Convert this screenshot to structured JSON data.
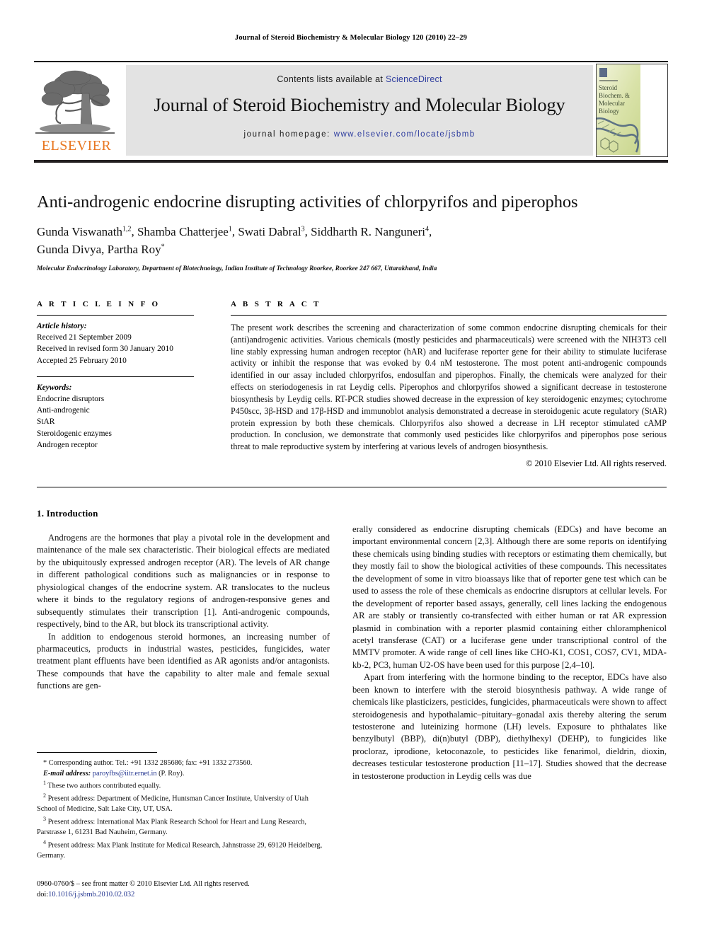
{
  "running_head": "Journal of Steroid Biochemistry & Molecular Biology 120 (2010) 22–29",
  "masthead": {
    "contents_prefix": "Contents lists available at",
    "sciencedirect": "ScienceDirect",
    "journal_title": "Journal of Steroid Biochemistry and Molecular Biology",
    "homepage_label": "journal homepage:",
    "homepage_url": "www.elsevier.com/locate/jsbmb",
    "publisher": "ELSEVIER",
    "cover_lines": [
      "Steroid",
      "Biochemistry &",
      "Molecular",
      "Biology"
    ],
    "colors": {
      "elsevier_orange": "#E87722",
      "link_blue": "#2d3c9e",
      "masthead_bg": "#e3e3e3"
    }
  },
  "article": {
    "title": "Anti-androgenic endocrine disrupting activities of chlorpyrifos and piperophos",
    "authors_line1": "Gunda Viswanath",
    "authors_line1_sup1": "1,2",
    "authors_line1_b": ", Shamba Chatterjee",
    "authors_line1_sup2": "1",
    "authors_line1_c": ", Swati Dabral",
    "authors_line1_sup3": "3",
    "authors_line1_d": ", Siddharth R. Nanguneri",
    "authors_line1_sup4": "4",
    "authors_line1_e": ",",
    "authors_line2": "Gunda Divya, Partha Roy",
    "authors_line2_star": "*",
    "affiliation": "Molecular Endocrinology Laboratory, Department of Biotechnology, Indian Institute of Technology Roorkee, Roorkee 247 667, Uttarakhand, India"
  },
  "article_info": {
    "heading": "A R T I C L E   I N F O",
    "history_label": "Article history:",
    "history": [
      "Received 21 September 2009",
      "Received in revised form 30 January 2010",
      "Accepted 25 February 2010"
    ],
    "keywords_label": "Keywords:",
    "keywords": [
      "Endocrine disruptors",
      "Anti-androgenic",
      "StAR",
      "Steroidogenic enzymes",
      "Androgen receptor"
    ]
  },
  "abstract": {
    "heading": "A B S T R A C T",
    "text": "The present work describes the screening and characterization of some common endocrine disrupting chemicals for their (anti)androgenic activities. Various chemicals (mostly pesticides and pharmaceuticals) were screened with the NIH3T3 cell line stably expressing human androgen receptor (hAR) and luciferase reporter gene for their ability to stimulate luciferase activity or inhibit the response that was evoked by 0.4 nM testosterone. The most potent anti-androgenic compounds identified in our assay included chlorpyrifos, endosulfan and piperophos. Finally, the chemicals were analyzed for their effects on steriodogenesis in rat Leydig cells. Piperophos and chlorpyrifos showed a significant decrease in testosterone biosynthesis by Leydig cells. RT-PCR studies showed decrease in the expression of key steroidogenic enzymes; cytochrome P450scc, 3β-HSD and 17β-HSD and immunoblot analysis demonstrated a decrease in steroidogenic acute regulatory (StAR) protein expression by both these chemicals. Chlorpyrifos also showed a decrease in LH receptor stimulated cAMP production. In conclusion, we demonstrate that commonly used pesticides like chlorpyrifos and piperophos pose serious threat to male reproductive system by interfering at various levels of androgen biosynthesis.",
    "copyright": "© 2010 Elsevier Ltd. All rights reserved."
  },
  "body": {
    "section1_heading": "1. Introduction",
    "left_paragraphs": [
      "Androgens are the hormones that play a pivotal role in the development and maintenance of the male sex characteristic. Their biological effects are mediated by the ubiquitously expressed androgen receptor (AR). The levels of AR change in different pathological conditions such as malignancies or in response to physiological changes of the endocrine system. AR translocates to the nucleus where it binds to the regulatory regions of androgen-responsive genes and subsequently stimulates their transcription [1]. Anti-androgenic compounds, respectively, bind to the AR, but block its transcriptional activity.",
      "In addition to endogenous steroid hormones, an increasing number of pharmaceutics, products in industrial wastes, pesticides, fungicides, water treatment plant effluents have been identified as AR agonists and/or antagonists. These compounds that have the capability to alter male and female sexual functions are gen-"
    ],
    "right_paragraphs": [
      "erally considered as endocrine disrupting chemicals (EDCs) and have become an important environmental concern [2,3]. Although there are some reports on identifying these chemicals using binding studies with receptors or estimating them chemically, but they mostly fail to show the biological activities of these compounds. This necessitates the development of some in vitro bioassays like that of reporter gene test which can be used to assess the role of these chemicals as endocrine disruptors at cellular levels. For the development of reporter based assays, generally, cell lines lacking the endogenous AR are stably or transiently co-transfected with either human or rat AR expression plasmid in combination with a reporter plasmid containing either chloramphenicol acetyl transferase (CAT) or a luciferase gene under transcriptional control of the MMTV promoter. A wide range of cell lines like CHO-K1, COS1, COS7, CV1, MDA-kb-2, PC3, human U2-OS have been used for this purpose [2,4–10].",
      "Apart from interfering with the hormone binding to the receptor, EDCs have also been known to interfere with the steroid biosynthesis pathway. A wide range of chemicals like plasticizers, pesticides, fungicides, pharmaceuticals were shown to affect steroidogenesis and hypothalamic–pituitary–gonadal axis thereby altering the serum testosterone and luteinizing hormone (LH) levels. Exposure to phthalates like benzylbutyl (BBP), di(n)butyl (DBP), diethylhexyl (DEHP), to fungicides like procloraz, iprodione, ketoconazole, to pesticides like fenarimol, dieldrin, dioxin, decreases testicular testosterone production [11–17]. Studies showed that the decrease in testosterone production in Leydig cells was due"
    ]
  },
  "footnotes": {
    "corresponding": "* Corresponding author. Tel.: +91 1332 285686; fax: +91 1332 273560.",
    "email_label": "E-mail address:",
    "email": "paroyfbs@iitr.ernet.in",
    "email_suffix": "(P. Roy).",
    "note1_sup": "1",
    "note1": "These two authors contributed equally.",
    "note2_sup": "2",
    "note2": "Present address: Department of Medicine, Huntsman Cancer Institute, University of Utah School of Medicine, Salt Lake City, UT, USA.",
    "note3_sup": "3",
    "note3": "Present address: International Max Plank Research School for Heart and Lung Research, Parstrasse 1, 61231 Bad Nauheim, Germany.",
    "note4_sup": "4",
    "note4": "Present address: Max Plank Institute for Medical Research, Jahnstrasse 29, 69120 Heidelberg, Germany."
  },
  "front_matter": {
    "issn_line": "0960-0760/$ – see front matter © 2010 Elsevier Ltd. All rights reserved.",
    "doi_label": "doi:",
    "doi": "10.1016/j.jsbmb.2010.02.032"
  }
}
